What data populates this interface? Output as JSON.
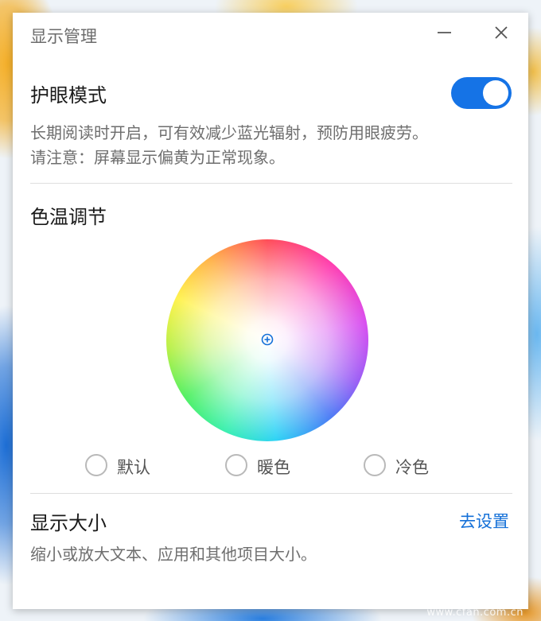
{
  "window": {
    "title": "显示管理",
    "minimize_icon": "minimize-icon",
    "close_icon": "close-icon"
  },
  "eye_care": {
    "title": "护眼模式",
    "toggle_on": true,
    "accent_color": "#1573e6",
    "description_line1": "长期阅读时开启，可有效减少蓝光辐射，预防用眼疲劳。",
    "description_line2": "请注意：屏幕显示偏黄为正常现象。"
  },
  "color_temperature": {
    "title": "色温调节",
    "picker_icon": "crosshair-icon",
    "options": [
      {
        "label": "默认",
        "selected": false
      },
      {
        "label": "暖色",
        "selected": false
      },
      {
        "label": "冷色",
        "selected": false
      }
    ]
  },
  "display_size": {
    "title": "显示大小",
    "link": "去设置",
    "link_color": "#1470d8",
    "description": "缩小或放大文本、应用和其他项目大小。"
  },
  "watermark": "www.cfan.com.cn"
}
